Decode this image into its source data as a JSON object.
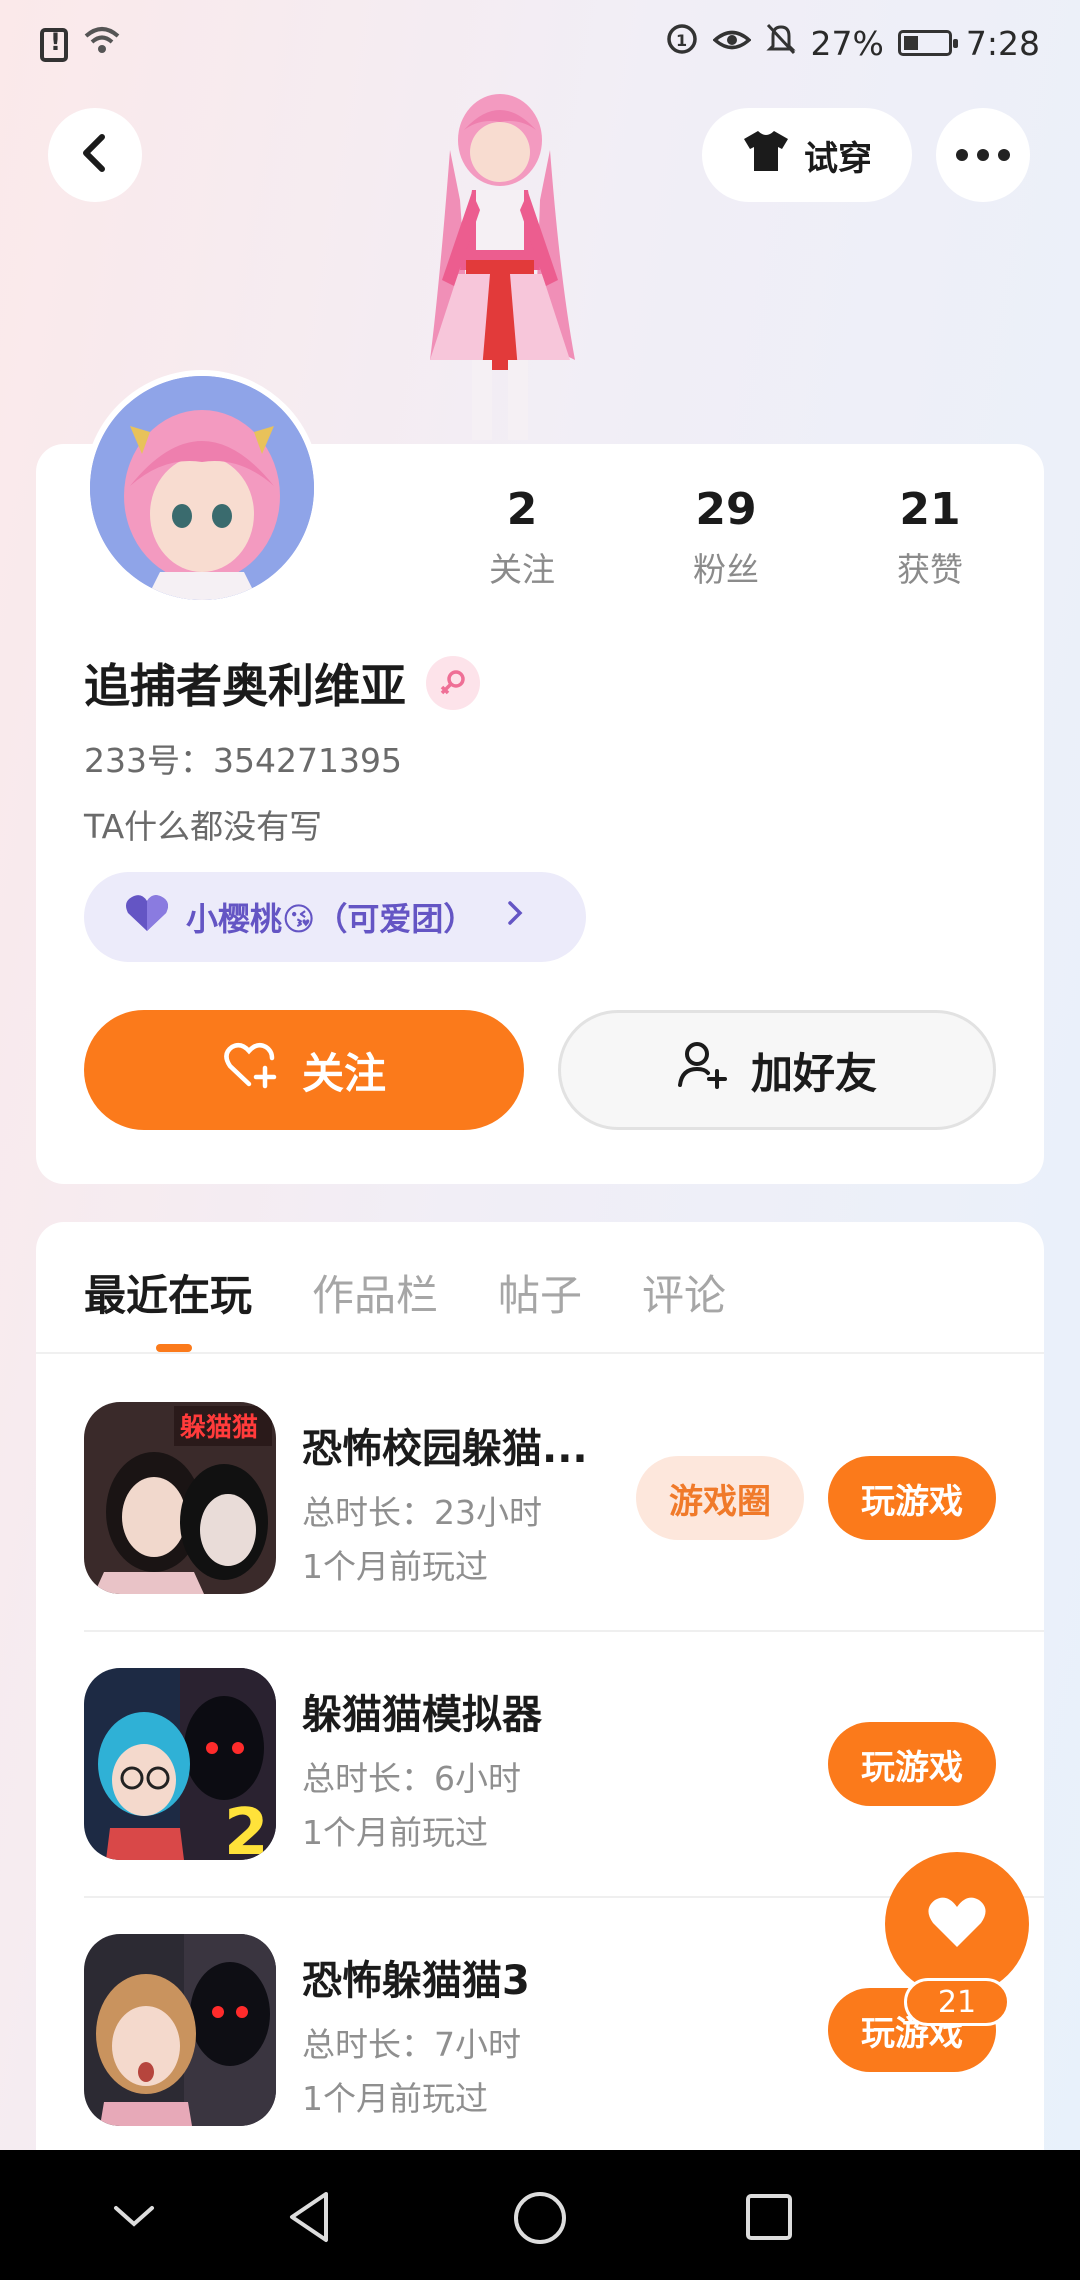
{
  "status_bar": {
    "battery": "27%",
    "time": "7:28"
  },
  "header": {
    "tryon_label": "试穿"
  },
  "profile": {
    "stats": [
      {
        "value": "2",
        "label": "关注"
      },
      {
        "value": "29",
        "label": "粉丝"
      },
      {
        "value": "21",
        "label": "获赞"
      }
    ],
    "name": "追捕者奥利维亚",
    "uid": "233号：354271395",
    "bio": "TA什么都没有写",
    "group": "小樱桃😘（可爱团）",
    "follow_label": "关注",
    "add_friend_label": "加好友"
  },
  "tabs": [
    "最近在玩",
    "作品栏",
    "帖子",
    "评论"
  ],
  "games": [
    {
      "title": "恐怖校园躲猫...",
      "duration": "总时长：23小时",
      "last_played": "1个月前玩过",
      "circle_label": "游戏圈",
      "play_label": "玩游戏",
      "icon_text": "躲猫猫"
    },
    {
      "title": "躲猫猫模拟器",
      "duration": "总时长：6小时",
      "last_played": "1个月前玩过",
      "play_label": "玩游戏",
      "icon_text": "2"
    },
    {
      "title": "恐怖躲猫猫3",
      "duration": "总时长：7小时",
      "last_played": "1个月前玩过",
      "play_label": "玩游戏"
    }
  ],
  "like_fab": {
    "count": "21"
  },
  "colors": {
    "accent": "#fb7a1b",
    "group_chip_bg": "#ecebfa",
    "group_chip_text": "#6455c4"
  }
}
